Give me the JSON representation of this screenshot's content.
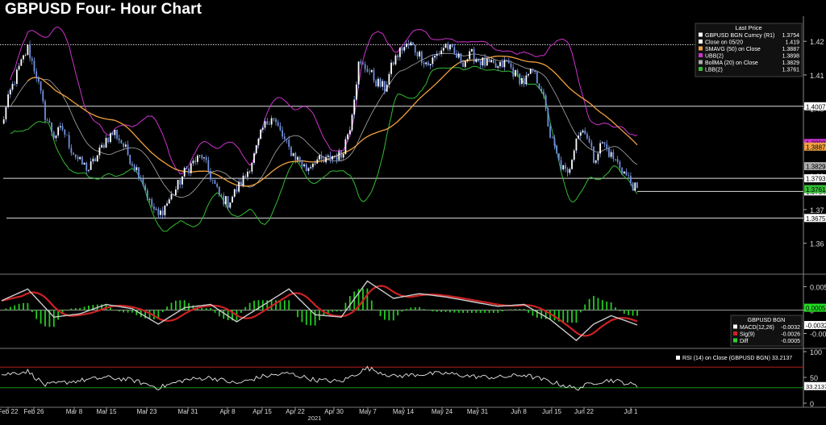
{
  "title": "GBPUSD Four- Hour Chart",
  "chart_data": [
    {
      "type": "line",
      "panel": "price",
      "title": "GBPUSD Four- Hour Chart",
      "legend_header": "Last Price",
      "legend_position": "top-right",
      "x_ticks": [
        "Feb 22",
        "Feb 26",
        "Mar 8",
        "Mar 15",
        "Mar 23",
        "Mar 31",
        "Apr 8",
        "Apr 15",
        "Apr 22",
        "Apr 30",
        "May 7",
        "May 14",
        "May 24",
        "May 31",
        "Jun 8",
        "Jun 15",
        "Jun 22",
        "Jul 1"
      ],
      "x_year_label": "2021",
      "y_ticks": [
        1.36,
        1.37,
        1.38,
        1.39,
        1.4,
        1.41,
        1.42
      ],
      "ylim": [
        1.352,
        1.427
      ],
      "series": [
        {
          "name": "GBPUSD BGN Curncy  (R1)",
          "last": "1.3754",
          "color": "#ffffff"
        },
        {
          "name": "Close on 05/20",
          "last": "1.419",
          "color": "#ffffff"
        },
        {
          "name": "SMAVG (50)  on Close",
          "last": "1.3887",
          "color": "#f0a040"
        },
        {
          "name": "UBB(2)",
          "last": "1.3898",
          "color": "#cc33cc"
        },
        {
          "name": "BollMA (20)  on Close",
          "last": "1.3829",
          "color": "#aaaaaa"
        },
        {
          "name": "LBB(2)",
          "last": "1.3761",
          "color": "#33bb33"
        }
      ],
      "reference_lines": [
        {
          "label": "1.4007",
          "value": 1.4007
        },
        {
          "label": "1.3793",
          "value": 1.3793
        },
        {
          "label": "1.3754",
          "value": 1.3754
        },
        {
          "label": "1.3675",
          "value": 1.3675
        },
        {
          "label": "1.419",
          "value": 1.419
        }
      ],
      "right_tags": [
        {
          "label": "1.3898",
          "value": 1.3898,
          "color": "#cc33cc"
        },
        {
          "label": "1.3887",
          "value": 1.3887,
          "color": "#f0a040"
        },
        {
          "label": "1.3829",
          "value": 1.3829,
          "color": "#aaaaaa"
        },
        {
          "label": "1.3761",
          "value": 1.3761,
          "color": "#33bb33"
        }
      ],
      "price_path": [
        [
          0,
          1.395
        ],
        [
          1,
          1.405
        ],
        [
          2,
          1.412
        ],
        [
          3,
          1.418
        ],
        [
          4,
          1.41
        ],
        [
          5,
          1.398
        ],
        [
          6,
          1.392
        ],
        [
          7,
          1.394
        ],
        [
          8,
          1.388
        ],
        [
          9,
          1.384
        ],
        [
          10,
          1.382
        ],
        [
          11,
          1.386
        ],
        [
          12,
          1.391
        ],
        [
          13,
          1.393
        ],
        [
          14,
          1.389
        ],
        [
          15,
          1.384
        ],
        [
          16,
          1.38
        ],
        [
          17,
          1.372
        ],
        [
          18,
          1.368
        ],
        [
          19,
          1.372
        ],
        [
          20,
          1.376
        ],
        [
          21,
          1.381
        ],
        [
          22,
          1.384
        ],
        [
          23,
          1.386
        ],
        [
          24,
          1.38
        ],
        [
          25,
          1.374
        ],
        [
          26,
          1.372
        ],
        [
          27,
          1.376
        ],
        [
          28,
          1.38
        ],
        [
          29,
          1.386
        ],
        [
          30,
          1.394
        ],
        [
          31,
          1.398
        ],
        [
          32,
          1.393
        ],
        [
          33,
          1.388
        ],
        [
          34,
          1.385
        ],
        [
          35,
          1.382
        ],
        [
          36,
          1.385
        ],
        [
          37,
          1.384
        ],
        [
          38,
          1.386
        ],
        [
          39,
          1.386
        ],
        [
          40,
          1.395
        ],
        [
          41,
          1.413
        ],
        [
          42,
          1.412
        ],
        [
          43,
          1.408
        ],
        [
          44,
          1.406
        ],
        [
          45,
          1.414
        ],
        [
          46,
          1.418
        ],
        [
          47,
          1.419
        ],
        [
          48,
          1.416
        ],
        [
          49,
          1.413
        ],
        [
          50,
          1.416
        ],
        [
          51,
          1.419
        ],
        [
          52,
          1.416
        ],
        [
          53,
          1.414
        ],
        [
          54,
          1.416
        ],
        [
          55,
          1.414
        ],
        [
          56,
          1.413
        ],
        [
          57,
          1.412
        ],
        [
          58,
          1.414
        ],
        [
          59,
          1.41
        ],
        [
          60,
          1.408
        ],
        [
          61,
          1.411
        ],
        [
          62,
          1.406
        ],
        [
          63,
          1.392
        ],
        [
          64,
          1.384
        ],
        [
          65,
          1.38
        ],
        [
          66,
          1.392
        ],
        [
          67,
          1.394
        ],
        [
          68,
          1.385
        ],
        [
          69,
          1.39
        ],
        [
          70,
          1.386
        ],
        [
          71,
          1.383
        ],
        [
          72,
          1.379
        ],
        [
          73,
          1.3754
        ]
      ]
    },
    {
      "type": "line",
      "panel": "macd",
      "legend_header": "GBPUSD BGN",
      "y_ticks": [
        0.005,
        0,
        -0.005
      ],
      "ylim": [
        -0.0075,
        0.0068
      ],
      "series": [
        {
          "name": "MACD(12,26)",
          "last": "-0.0032",
          "color": "#ffffff"
        },
        {
          "name": "Sig(9)",
          "last": "-0.0026",
          "color": "#cc2222"
        },
        {
          "name": "Diff",
          "last": "-0.0005",
          "color": "#33cc33"
        }
      ],
      "right_tags": [
        {
          "label": "0.0005",
          "value": 0.0005,
          "color": "#22dd22"
        },
        {
          "label": "-0.0032",
          "value": -0.0032,
          "color": "#ffffff"
        }
      ],
      "macd_path": [
        [
          0,
          0.002
        ],
        [
          3,
          0.0045
        ],
        [
          6,
          -0.0015
        ],
        [
          9,
          -0.0008
        ],
        [
          12,
          0.0012
        ],
        [
          15,
          0.0003
        ],
        [
          18,
          -0.003
        ],
        [
          21,
          0.0005
        ],
        [
          24,
          0.0012
        ],
        [
          27,
          -0.0025
        ],
        [
          30,
          0.001
        ],
        [
          33,
          0.0045
        ],
        [
          36,
          -0.001
        ],
        [
          39,
          -0.0015
        ],
        [
          42,
          0.0062
        ],
        [
          45,
          0.0025
        ],
        [
          48,
          0.0035
        ],
        [
          51,
          0.0028
        ],
        [
          54,
          0.0018
        ],
        [
          57,
          0.0008
        ],
        [
          60,
          0.0012
        ],
        [
          63,
          -0.002
        ],
        [
          66,
          -0.0065
        ],
        [
          68,
          -0.003
        ],
        [
          70,
          -0.0012
        ],
        [
          72,
          -0.0025
        ],
        [
          73,
          -0.0032
        ]
      ]
    },
    {
      "type": "line",
      "panel": "rsi",
      "y_ticks": [
        100,
        50,
        0
      ],
      "ylim": [
        0,
        100
      ],
      "reference_levels": [
        70,
        30
      ],
      "series": [
        {
          "name": "RSI (14)  on Close (GBPUSD BGN)",
          "last": "33.2137",
          "color": "#ffffff"
        }
      ],
      "right_tags": [
        {
          "label": "33.2137",
          "value": 33.2137,
          "color": "#ffffff"
        }
      ],
      "rsi_path": [
        [
          0,
          55
        ],
        [
          3,
          62
        ],
        [
          5,
          35
        ],
        [
          8,
          42
        ],
        [
          12,
          50
        ],
        [
          15,
          45
        ],
        [
          18,
          30
        ],
        [
          21,
          45
        ],
        [
          24,
          50
        ],
        [
          27,
          38
        ],
        [
          30,
          52
        ],
        [
          33,
          58
        ],
        [
          36,
          45
        ],
        [
          39,
          42
        ],
        [
          42,
          68
        ],
        [
          45,
          52
        ],
        [
          48,
          56
        ],
        [
          51,
          58
        ],
        [
          54,
          52
        ],
        [
          57,
          50
        ],
        [
          60,
          55
        ],
        [
          63,
          42
        ],
        [
          66,
          28
        ],
        [
          68,
          40
        ],
        [
          70,
          45
        ],
        [
          72,
          38
        ],
        [
          73,
          33.2137
        ]
      ]
    }
  ]
}
